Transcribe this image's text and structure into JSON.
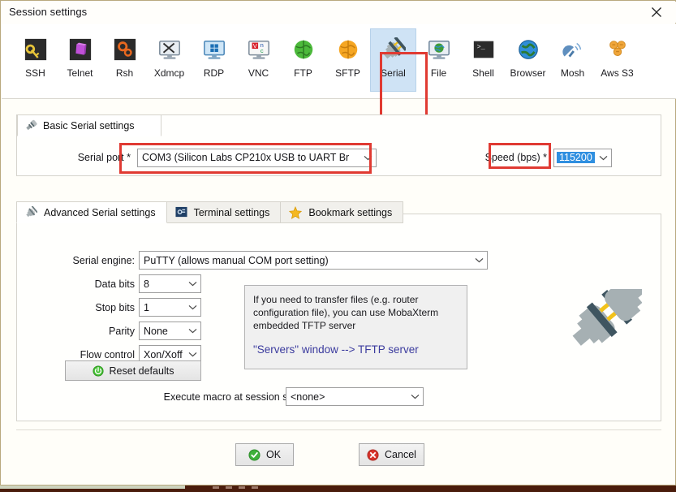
{
  "window": {
    "title": "Session settings",
    "close_icon": "close-icon"
  },
  "toolbar": {
    "items": [
      {
        "label": "SSH",
        "icon": "key-icon"
      },
      {
        "label": "Telnet",
        "icon": "telnet-icon"
      },
      {
        "label": "Rsh",
        "icon": "gears-icon"
      },
      {
        "label": "Xdmcp",
        "icon": "xdmcp-monitor-icon"
      },
      {
        "label": "RDP",
        "icon": "windows-monitor-icon"
      },
      {
        "label": "VNC",
        "icon": "vnc-monitor-icon"
      },
      {
        "label": "FTP",
        "icon": "green-globe-icon"
      },
      {
        "label": "SFTP",
        "icon": "orange-globe-icon"
      },
      {
        "label": "Serial",
        "icon": "serial-plug-icon",
        "selected": true
      },
      {
        "label": "File",
        "icon": "file-monitor-icon"
      },
      {
        "label": "Shell",
        "icon": "terminal-icon"
      },
      {
        "label": "Browser",
        "icon": "blue-globe-icon"
      },
      {
        "label": "Mosh",
        "icon": "satellite-dish-icon"
      },
      {
        "label": "Aws S3",
        "icon": "aws-s3-icon"
      }
    ]
  },
  "basic_panel": {
    "tab_label": "Basic Serial settings",
    "tab_icon": "serial-plug-icon",
    "serial_port_label": "Serial port *",
    "serial_port_value": "COM3   (Silicon Labs CP210x USB to UART Br",
    "speed_label": "Speed (bps) *",
    "speed_value": "115200"
  },
  "tabs": [
    {
      "label": "Advanced Serial settings",
      "icon": "serial-plug-icon",
      "active": true
    },
    {
      "label": "Terminal settings",
      "icon": "terminal-settings-icon",
      "active": false
    },
    {
      "label": "Bookmark settings",
      "icon": "star-icon",
      "active": false
    }
  ],
  "advanced": {
    "serial_engine_label": "Serial engine:",
    "serial_engine_value": "PuTTY   (allows manual COM port setting)",
    "data_bits_label": "Data bits",
    "data_bits_value": "8",
    "stop_bits_label": "Stop bits",
    "stop_bits_value": "1",
    "parity_label": "Parity",
    "parity_value": "None",
    "flow_control_label": "Flow control",
    "flow_control_value": "Xon/Xoff",
    "reset_defaults_label": "Reset defaults",
    "reset_defaults_icon": "power-icon",
    "macro_label": "Execute macro at session start:",
    "macro_value": "<none>",
    "info_line1": "If you need to transfer files (e.g. router",
    "info_line2": "configuration file), you can use MobaXterm",
    "info_line3": "embedded TFTP server",
    "info_highlight": "\"Servers\" window  -->  TFTP server",
    "plug_graphic_icon": "serial-plug-large-icon"
  },
  "footer": {
    "ok_label": "OK",
    "ok_icon": "check-circle-icon",
    "cancel_label": "Cancel",
    "cancel_icon": "cross-circle-icon"
  },
  "colors": {
    "highlight_red": "#e03a32",
    "selection_blue": "#2f8fe0",
    "selected_tool_bg": "#cfe3f5",
    "info_link": "#3b3b9e"
  }
}
